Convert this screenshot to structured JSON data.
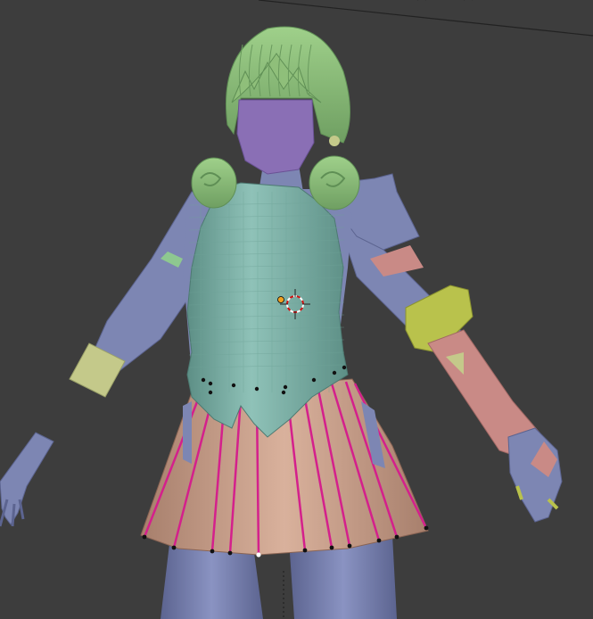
{
  "viewport": {
    "mode": "3d-viewport",
    "background": "#3d3d3d",
    "grid_line_color": "#202020"
  },
  "model": {
    "colors": {
      "hair": "#8fbf7a",
      "hair_shadow": "#5f8f55",
      "face": "#8a6fb5",
      "skin_body": "#7d86b3",
      "skin_shadow": "#5c6490",
      "bodice": "#7fb2a8",
      "bodice_shadow": "#5d8f86",
      "skirt": "#cfa690",
      "skirt_shadow": "#a77f6c",
      "pleat_edge": "#d4208c",
      "cuff": "#c4c98a",
      "gauntlet": "#c98a86",
      "armor_plate": "#7d86b3",
      "bracer": "#b9c24c",
      "band_green": "#8ec890",
      "vertex_dot": "#111111"
    }
  },
  "cursor_3d": {
    "icon": "3d-cursor-icon",
    "ring_color_a": "#ffffff",
    "ring_color_b": "#d11010"
  },
  "origin_marker": {
    "icon": "object-origin-dot",
    "color": "#f0a020"
  }
}
